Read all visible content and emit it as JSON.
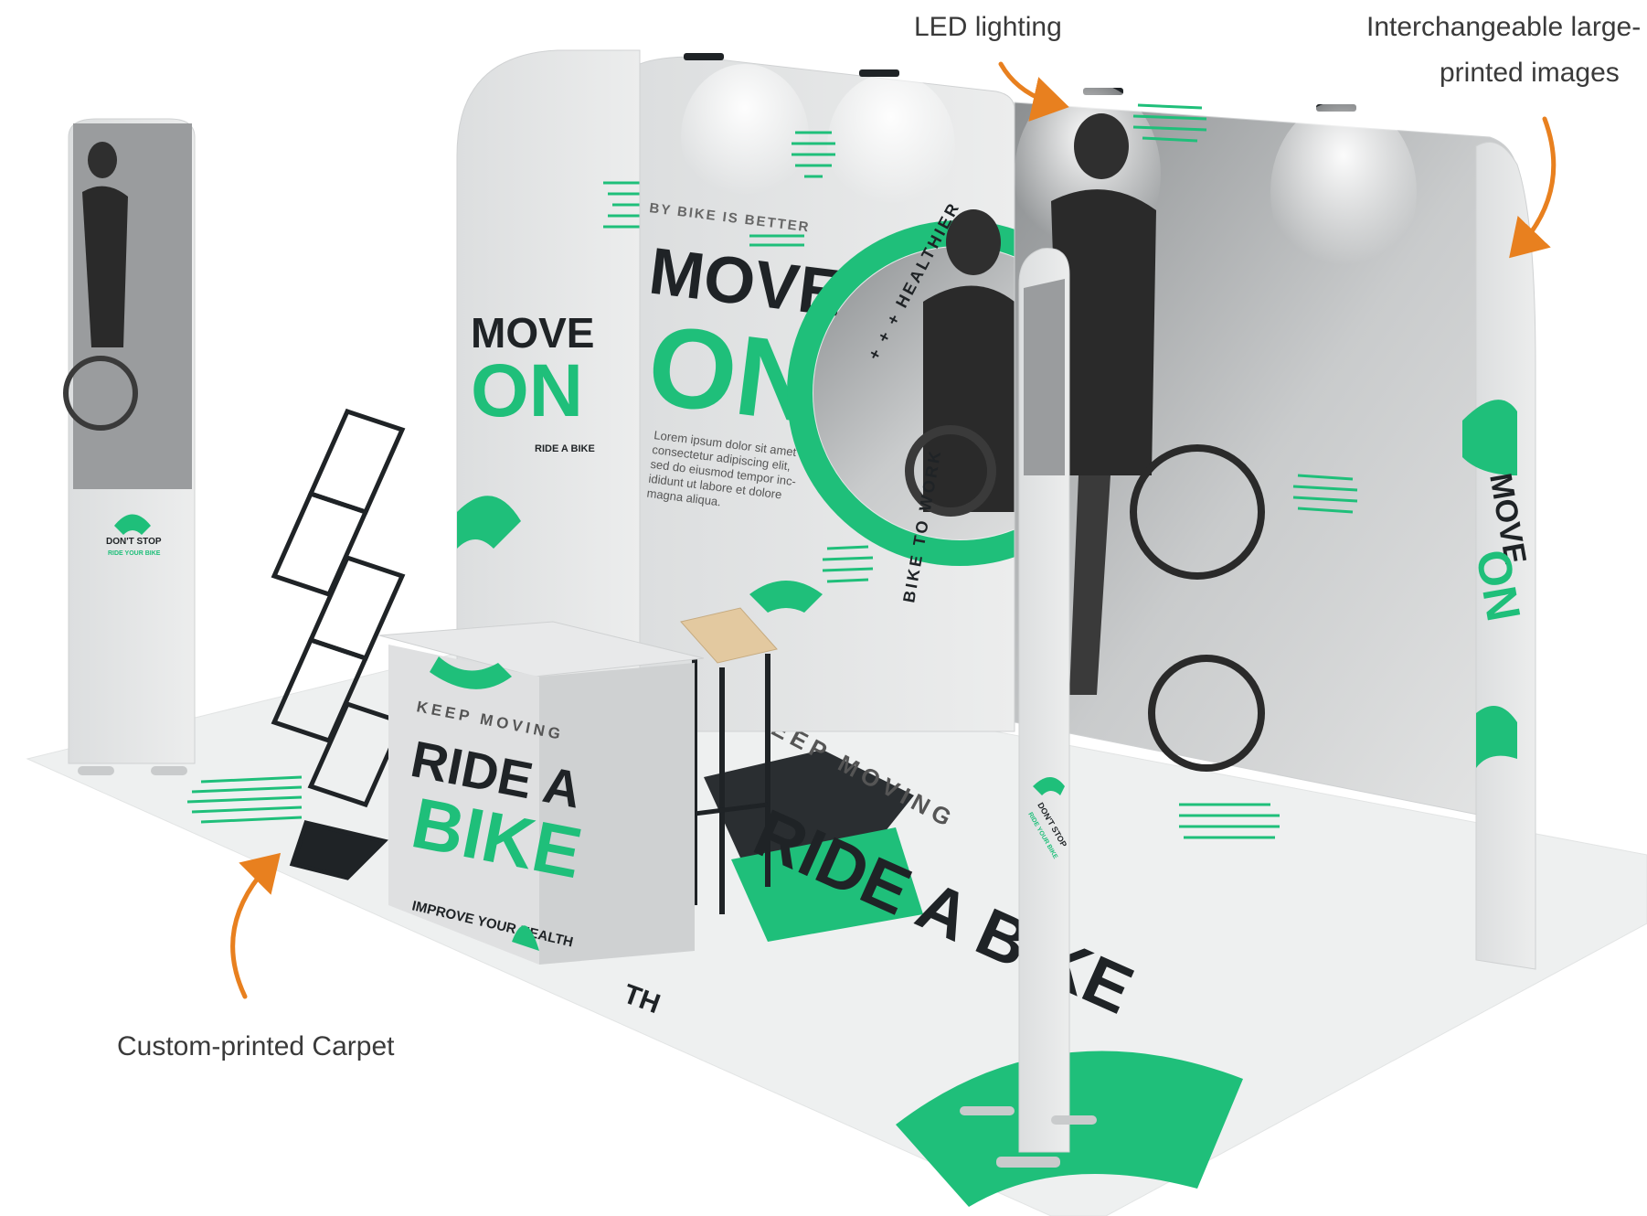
{
  "callouts": {
    "led_lighting": "LED lighting",
    "interchangeable_line1": "Interchangeable large-format",
    "interchangeable_line2": "printed images",
    "carpet": "Custom-printed Carpet"
  },
  "left_tower": {
    "heading": "DON'T STOP",
    "sub": "RIDE YOUR BIKE"
  },
  "back_left_panel": {
    "line1": "MOVE",
    "line2": "ON",
    "tagline": "RIDE A BIKE"
  },
  "back_center_panel": {
    "small_caps": "BY BIKE IS BETTER",
    "line1": "MOVE",
    "line2": "ON",
    "body": [
      "Lorem ipsum dolor sit amet",
      "consectetur adipiscing elit,",
      "sed do eiusmod tempor inc-",
      "ididunt ut labore et dolore",
      "magna aliqua."
    ],
    "ring_text_top": "+ + + HEALTHIER",
    "ring_text_side": "BIKE TO WORK"
  },
  "right_panel": {
    "line1": "MOVE",
    "line2": "ON"
  },
  "counter": {
    "small_caps": "KEEP MOVING",
    "line1": "RIDE A",
    "line2": "BIKE",
    "footer": "IMPROVE YOUR HEALTH"
  },
  "carpet": {
    "arc_text": "KEEP MOVING",
    "big_text": "RIDE A BIKE",
    "fragment": "TH"
  },
  "divider_tower": {
    "heading": "DON'T STOP",
    "sub": "RIDE YOUR BIKE"
  },
  "colors": {
    "accent_green": "#1fbf7a",
    "callout_orange": "#e8801f",
    "panel_gray": "#e6e7e8",
    "dark": "#1f2326"
  }
}
